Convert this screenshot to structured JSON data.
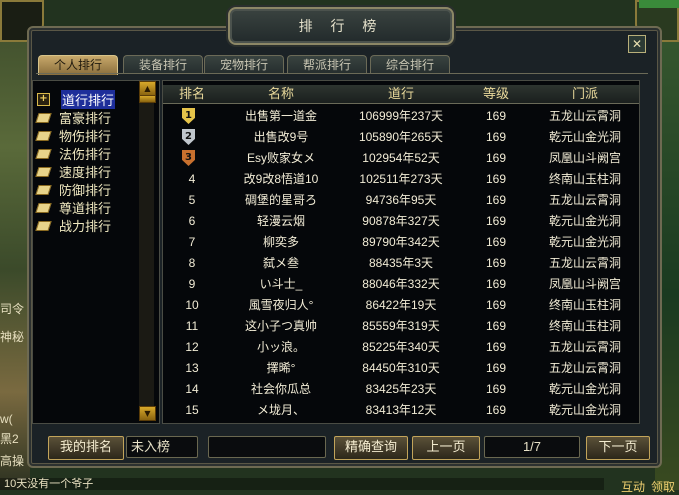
{
  "window": {
    "title": "排 行 榜",
    "close_label": "✕"
  },
  "tabs": [
    {
      "label": "个人排行",
      "active": true
    },
    {
      "label": "装备排行",
      "active": false
    },
    {
      "label": "宠物排行",
      "active": false
    },
    {
      "label": "帮派排行",
      "active": false
    },
    {
      "label": "综合排行",
      "active": false
    }
  ],
  "categories": [
    {
      "label": "道行排行",
      "icon": "plus-icon",
      "selected": true
    },
    {
      "label": "富豪排行",
      "icon": "book-icon",
      "selected": false
    },
    {
      "label": "物伤排行",
      "icon": "book-icon",
      "selected": false
    },
    {
      "label": "法伤排行",
      "icon": "book-icon",
      "selected": false
    },
    {
      "label": "速度排行",
      "icon": "book-icon",
      "selected": false
    },
    {
      "label": "防御排行",
      "icon": "book-icon",
      "selected": false
    },
    {
      "label": "尊道排行",
      "icon": "book-icon",
      "selected": false
    },
    {
      "label": "战力排行",
      "icon": "book-icon",
      "selected": false
    }
  ],
  "table": {
    "headers": [
      "排名",
      "名称",
      "道行",
      "等级",
      "门派"
    ],
    "rows": [
      {
        "rank": "1",
        "name": "出售第一道金",
        "value": "106999年237天",
        "level": "169",
        "school": "五龙山云霄洞"
      },
      {
        "rank": "2",
        "name": "出售改9号",
        "value": "105890年265天",
        "level": "169",
        "school": "乾元山金光洞"
      },
      {
        "rank": "3",
        "name": "Esy败家女メ",
        "value": "102954年52天",
        "level": "169",
        "school": "凤凰山斗阙宫"
      },
      {
        "rank": "4",
        "name": "改9改8悟道10",
        "value": "102511年273天",
        "level": "169",
        "school": "终南山玉柱洞"
      },
      {
        "rank": "5",
        "name": "碉堡的星哥ろ",
        "value": "94736年95天",
        "level": "169",
        "school": "五龙山云霄洞"
      },
      {
        "rank": "6",
        "name": "轻漫云烟",
        "value": "90878年327天",
        "level": "169",
        "school": "乾元山金光洞"
      },
      {
        "rank": "7",
        "name": "柳奕多",
        "value": "89790年342天",
        "level": "169",
        "school": "乾元山金光洞"
      },
      {
        "rank": "8",
        "name": "弑メ叁",
        "value": "88435年3天",
        "level": "169",
        "school": "五龙山云霄洞"
      },
      {
        "rank": "9",
        "name": "い斗士_",
        "value": "88046年332天",
        "level": "169",
        "school": "凤凰山斗阙宫"
      },
      {
        "rank": "10",
        "name": "風雪夜归人°",
        "value": "86422年19天",
        "level": "169",
        "school": "终南山玉柱洞"
      },
      {
        "rank": "11",
        "name": "这小子つ真帅",
        "value": "85559年319天",
        "level": "169",
        "school": "终南山玉柱洞"
      },
      {
        "rank": "12",
        "name": "小ッ浪。",
        "value": "85225年340天",
        "level": "169",
        "school": "五龙山云霄洞"
      },
      {
        "rank": "13",
        "name": "擇晞°",
        "value": "84450年310天",
        "level": "169",
        "school": "五龙山云霄洞"
      },
      {
        "rank": "14",
        "name": "社会你瓜总",
        "value": "83425年23天",
        "level": "169",
        "school": "乾元山金光洞"
      },
      {
        "rank": "15",
        "name": "メ垅月、",
        "value": "83413年12天",
        "level": "169",
        "school": "乾元山金光洞"
      }
    ]
  },
  "bottom": {
    "my_rank_button": "我的排名",
    "my_rank_value": "未入榜",
    "search_value": "",
    "search_button": "精确查询",
    "prev_button": "上一页",
    "page_indicator": "1/7",
    "next_button": "下一页"
  },
  "background_ui": {
    "chat_line": "10天没有一个爷子",
    "side_texts": [
      "司令",
      "神秘",
      "w(",
      "黑2",
      "高操"
    ],
    "corner_buttons": [
      "互动",
      "领取"
    ]
  },
  "colors": {
    "accent_gold": "#c2a45a",
    "selected_item": "#1e2e9a",
    "header_text": "#e8d89a"
  }
}
